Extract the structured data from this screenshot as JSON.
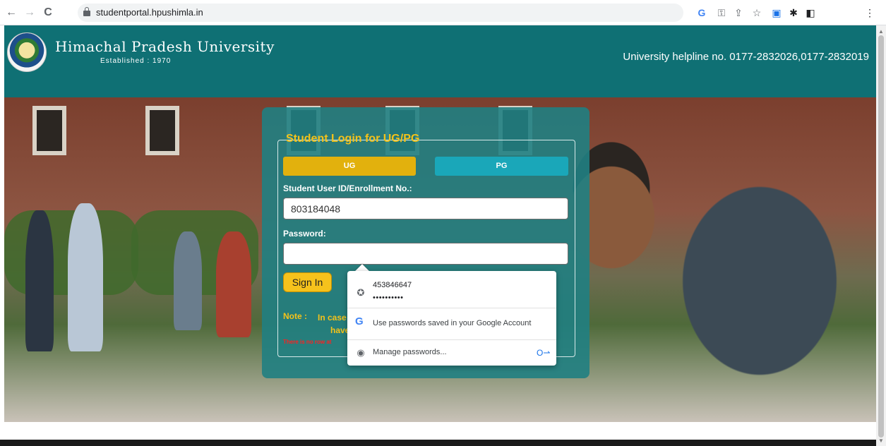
{
  "browser": {
    "url": "studentportal.hpushimla.in",
    "back_glyph": "←",
    "forward_glyph": "→",
    "reload_glyph": "C",
    "icons": [
      "google-lens-icon",
      "key-icon",
      "share-icon",
      "star-icon",
      "extension-icon",
      "puzzle-icon",
      "sidebar-icon",
      "menu-icon"
    ]
  },
  "header": {
    "university_name": "Himachal Pradesh University",
    "established": "Established : 1970",
    "helpline": "University helpline no. 0177-2832026,0177-2832019"
  },
  "login": {
    "legend": "Student Login for UG/PG",
    "tab_ug": "UG",
    "tab_pg": "PG",
    "userid_label": "Student User ID/Enrollment No.:",
    "userid_value": "803184048",
    "password_label": "Password:",
    "password_value": "",
    "signin_label": "Sign In",
    "note_label": "Note :",
    "note_line1": "In case",
    "note_line2": "have g",
    "error_text": "There is no row at"
  },
  "autofill": {
    "saved_user": "453846647",
    "saved_password_mask": "••••••••••",
    "google_option": "Use passwords saved in your Google Account",
    "manage_option": "Manage passwords..."
  },
  "colors": {
    "header_bg": "#0f7074",
    "panel_bg": "#208082",
    "ug_tab": "#e2b10d",
    "pg_tab": "#1aa7b9",
    "accent_yellow": "#f4c21a",
    "error_red": "#ff2020"
  }
}
